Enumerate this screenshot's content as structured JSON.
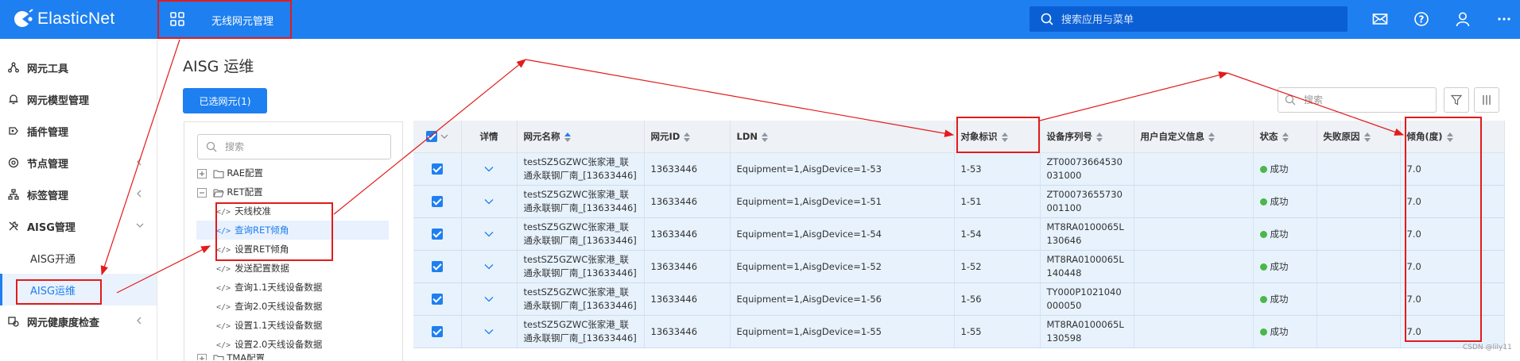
{
  "header": {
    "logo_text": "ElasticNet",
    "app_title": "无线网元管理",
    "search_placeholder": "搜索应用与菜单",
    "colors": {
      "bar": "#1e7ff0",
      "search": "#0a5fd4"
    },
    "icons": [
      "apps-grid-icon",
      "mail-icon",
      "help-icon",
      "user-icon",
      "more-icon"
    ]
  },
  "sidebar": {
    "items": [
      {
        "label": "网元工具",
        "icon": "network-icon"
      },
      {
        "label": "网元模型管理",
        "icon": "bell-icon"
      },
      {
        "label": "插件管理",
        "icon": "plugin-icon"
      },
      {
        "label": "节点管理",
        "icon": "node-gear-icon"
      },
      {
        "label": "标签管理",
        "icon": "tag-tree-icon"
      },
      {
        "label": "AISG管理",
        "icon": "tools-icon",
        "expanded": true
      },
      {
        "label": "网元健康度检查",
        "icon": "health-icon"
      }
    ],
    "sub_items": [
      {
        "label": "AISG开通",
        "active": false
      },
      {
        "label": "AISG运维",
        "active": true
      }
    ]
  },
  "main": {
    "page_title": "AISG 运维",
    "selected_button": "已选网元(1)",
    "tree": {
      "search_placeholder": "搜索",
      "folders": [
        {
          "toggle": "+",
          "label": "RAE配置"
        },
        {
          "toggle": "−",
          "label": "RET配置"
        }
      ],
      "code_glyph": "</>",
      "leaves": [
        {
          "label": "天线校准",
          "selected": false
        },
        {
          "label": "查询RET倾角",
          "selected": true
        },
        {
          "label": "设置RET倾角",
          "selected": false
        },
        {
          "label": "发送配置数据",
          "selected": false
        },
        {
          "label": "查询1.1天线设备数据",
          "selected": false
        },
        {
          "label": "查询2.0天线设备数据",
          "selected": false
        },
        {
          "label": "设置1.1天线设备数据",
          "selected": false
        },
        {
          "label": "设置2.0天线设备数据",
          "selected": false
        }
      ],
      "last_folder_partial": "TMA配置"
    },
    "table": {
      "search_placeholder": "搜索",
      "columns": [
        "",
        "详情",
        "网元名称",
        "网元ID",
        "LDN",
        "对象标识",
        "设备序列号",
        "用户自定义信息",
        "状态",
        "失败原因",
        "倾角(度)"
      ],
      "rows": [
        {
          "name": "testSZ5GZWC张家港_联通永联钢厂南_[13633446]",
          "id": "13633446",
          "ldn": "Equipment=1,AisgDevice=1-53",
          "obj": "1-53",
          "serial": "ZT00073664530031000",
          "custom": "",
          "status": "成功",
          "reason": "",
          "tilt": "7.0"
        },
        {
          "name": "testSZ5GZWC张家港_联通永联钢厂南_[13633446]",
          "id": "13633446",
          "ldn": "Equipment=1,AisgDevice=1-51",
          "obj": "1-51",
          "serial": "ZT00073655730001100",
          "custom": "",
          "status": "成功",
          "reason": "",
          "tilt": "7.0"
        },
        {
          "name": "testSZ5GZWC张家港_联通永联钢厂南_[13633446]",
          "id": "13633446",
          "ldn": "Equipment=1,AisgDevice=1-54",
          "obj": "1-54",
          "serial": "MT8RA0100065L130646",
          "custom": "",
          "status": "成功",
          "reason": "",
          "tilt": "7.0"
        },
        {
          "name": "testSZ5GZWC张家港_联通永联钢厂南_[13633446]",
          "id": "13633446",
          "ldn": "Equipment=1,AisgDevice=1-52",
          "obj": "1-52",
          "serial": "MT8RA0100065L140448",
          "custom": "",
          "status": "成功",
          "reason": "",
          "tilt": "7.0"
        },
        {
          "name": "testSZ5GZWC张家港_联通永联钢厂南_[13633446]",
          "id": "13633446",
          "ldn": "Equipment=1,AisgDevice=1-56",
          "obj": "1-56",
          "serial": "TY000P1021040000050",
          "custom": "",
          "status": "成功",
          "reason": "",
          "tilt": "7.0"
        },
        {
          "name": "testSZ5GZWC张家港_联通永联钢厂南_[13633446]",
          "id": "13633446",
          "ldn": "Equipment=1,AisgDevice=1-55",
          "obj": "1-55",
          "serial": "MT8RA0100065L130598",
          "custom": "",
          "status": "成功",
          "reason": "",
          "tilt": "7.0"
        }
      ]
    }
  },
  "watermark": "CSDN @lily11",
  "annotation_color": "#e31b1b"
}
